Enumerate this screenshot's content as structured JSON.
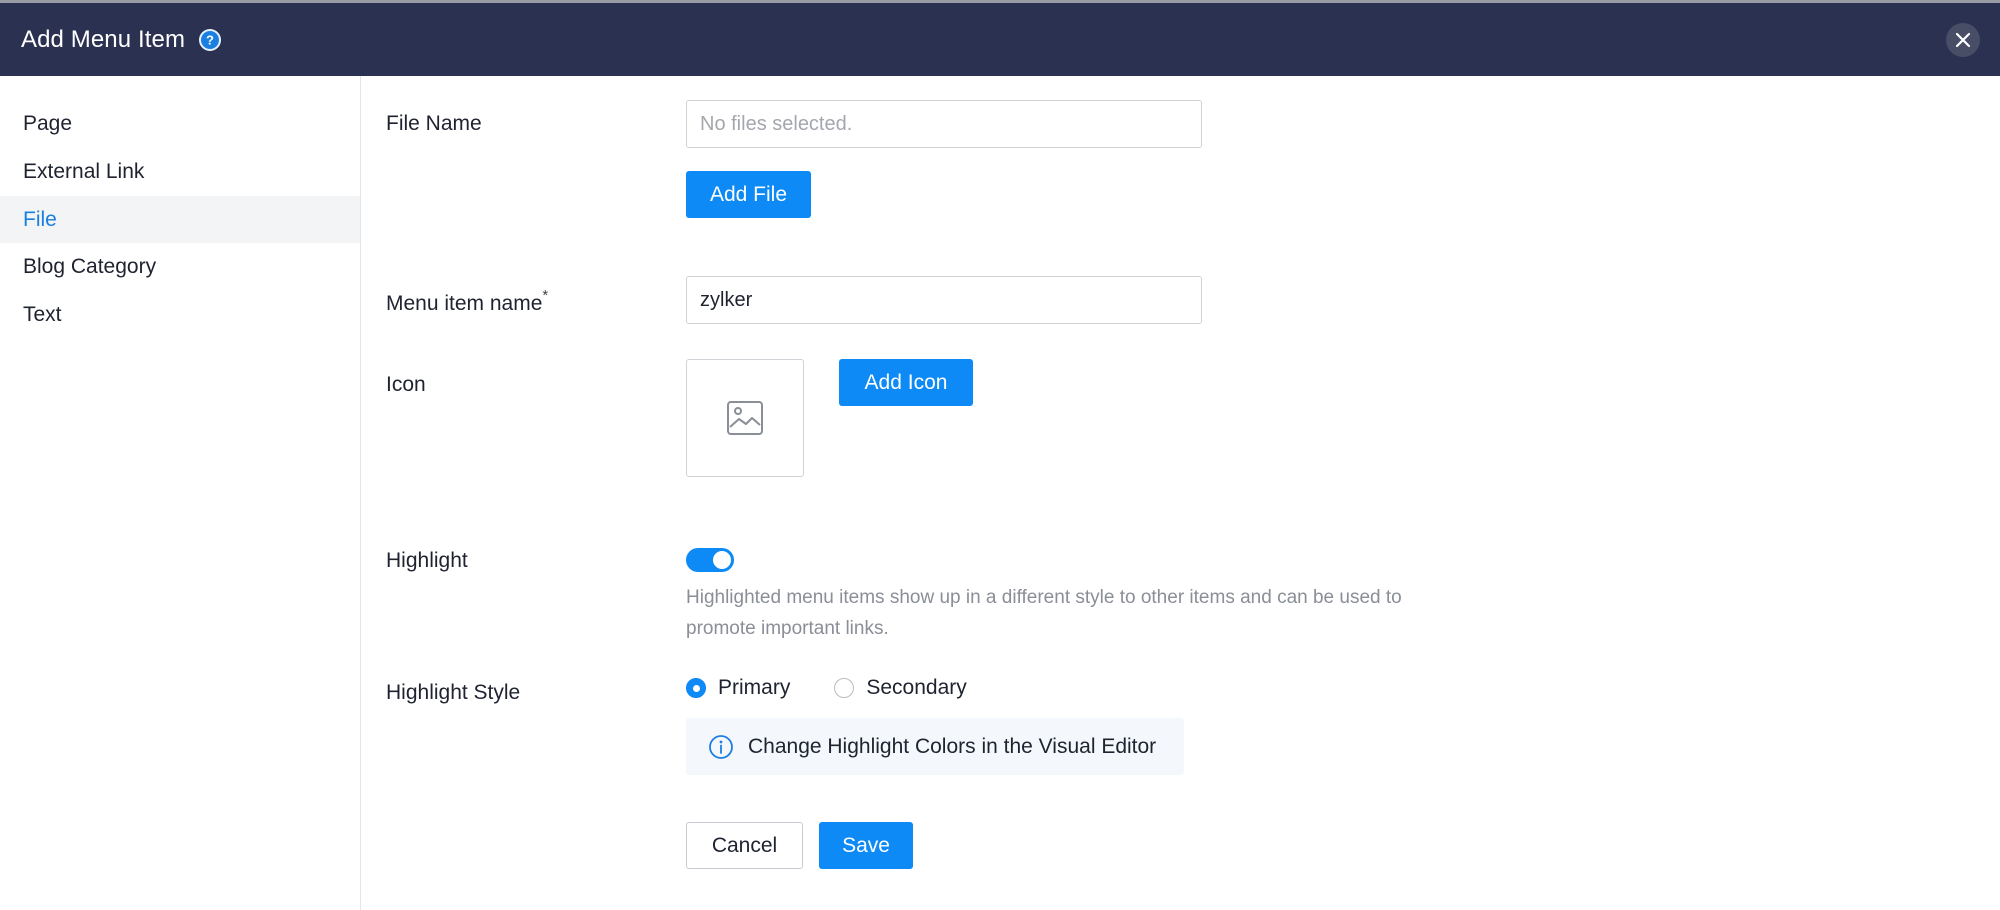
{
  "header": {
    "title": "Add Menu Item",
    "help_icon": "question-icon",
    "close_icon": "close-icon",
    "background": "#2b3150"
  },
  "sidebar": {
    "items": [
      {
        "label": "Page"
      },
      {
        "label": "External Link"
      },
      {
        "label": "File",
        "active": true
      },
      {
        "label": "Blog Category"
      },
      {
        "label": "Text"
      }
    ]
  },
  "form": {
    "file_name": {
      "label": "File Name",
      "value": "",
      "placeholder": "No files selected.",
      "add_button": "Add File"
    },
    "menu_item_name": {
      "label": "Menu item name",
      "required_mark": "*",
      "value": "zylker"
    },
    "icon": {
      "label": "Icon",
      "placeholder_icon": "image-icon",
      "add_button": "Add Icon"
    },
    "highlight": {
      "label": "Highlight",
      "enabled": true,
      "help_text": "Highlighted menu items show up in a different style to other items and can be used to promote important links."
    },
    "highlight_style": {
      "label": "Highlight Style",
      "options": [
        {
          "label": "Primary",
          "selected": true
        },
        {
          "label": "Secondary",
          "selected": false
        }
      ],
      "info_icon": "info-icon",
      "info_text": "Change Highlight Colors in the Visual Editor"
    },
    "actions": {
      "cancel": "Cancel",
      "save": "Save"
    }
  },
  "colors": {
    "accent": "#0d8af5",
    "active_text": "#1a7fe0"
  }
}
